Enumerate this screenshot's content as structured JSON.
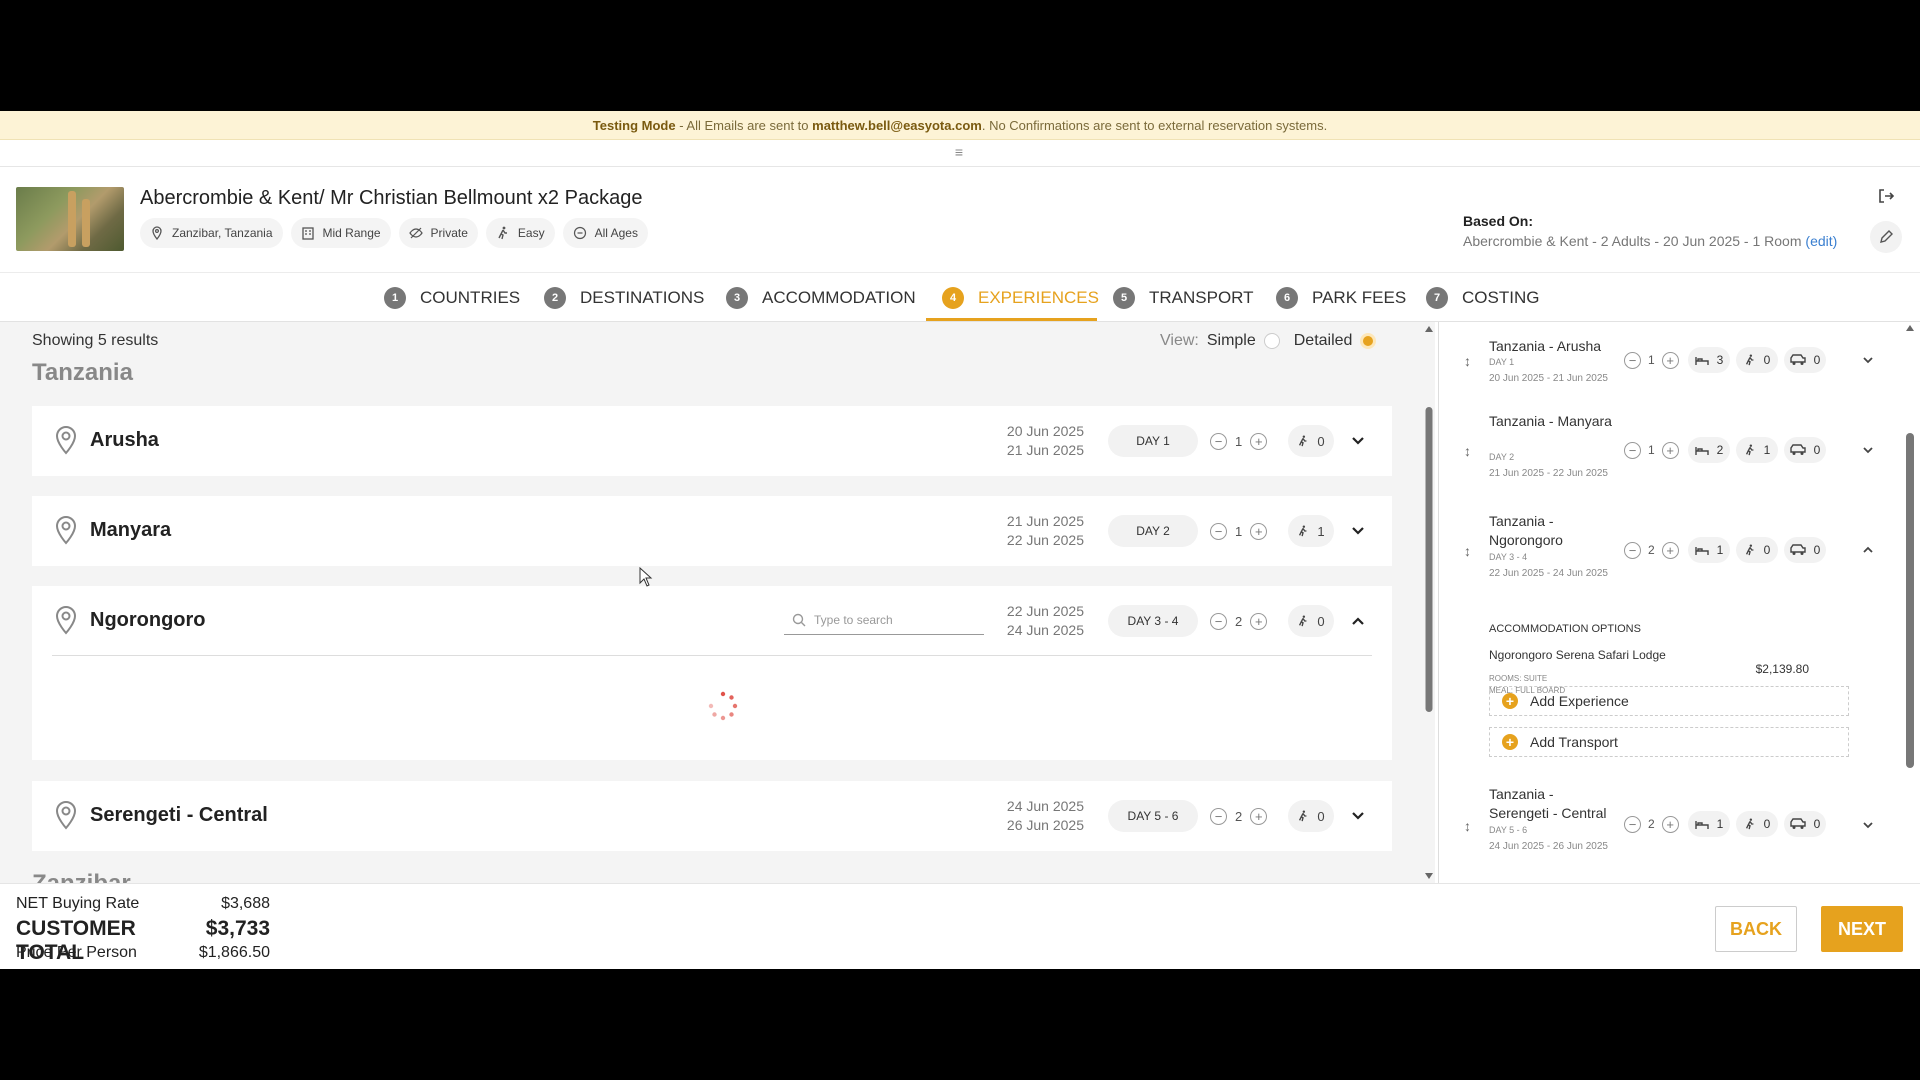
{
  "banner": {
    "mode": "Testing Mode",
    "pre": " - All Emails are sent to ",
    "email": "matthew.bell@easyota.com",
    "post": ". No Confirmations are sent to external reservation systems."
  },
  "drawer_handle": "≡",
  "package": {
    "title": "Abercrombie & Kent/ Mr Christian Bellmount x2 Package",
    "tags": [
      "Zanzibar, Tanzania",
      "Mid Range",
      "Private",
      "Easy",
      "All Ages"
    ]
  },
  "based_on": {
    "label": "Based On:",
    "value": "Abercrombie & Kent - 2 Adults - 20 Jun 2025 - 1 Room",
    "edit": "(edit)"
  },
  "steps": [
    {
      "num": "1",
      "label": "COUNTRIES"
    },
    {
      "num": "2",
      "label": "DESTINATIONS"
    },
    {
      "num": "3",
      "label": "ACCOMMODATION"
    },
    {
      "num": "4",
      "label": "EXPERIENCES"
    },
    {
      "num": "5",
      "label": "TRANSPORT"
    },
    {
      "num": "6",
      "label": "PARK FEES"
    },
    {
      "num": "7",
      "label": "COSTING"
    }
  ],
  "results": {
    "showing": "Showing 5 results",
    "view_label": "View:",
    "simple": "Simple",
    "detailed": "Detailed",
    "selected_view": "Detailed"
  },
  "countries": [
    "Tanzania",
    "Zanzibar"
  ],
  "search_placeholder": "Type to search",
  "destinations": [
    {
      "name": "Arusha",
      "date_from": "20 Jun 2025",
      "date_to": "21 Jun 2025",
      "day": "DAY 1",
      "nights": "1",
      "activities": "0"
    },
    {
      "name": "Manyara",
      "date_from": "21 Jun 2025",
      "date_to": "22 Jun 2025",
      "day": "DAY 2",
      "nights": "1",
      "activities": "1"
    },
    {
      "name": "Ngorongoro",
      "date_from": "22 Jun 2025",
      "date_to": "24 Jun 2025",
      "day": "DAY 3 - 4",
      "nights": "2",
      "activities": "0"
    },
    {
      "name": "Serengeti - Central",
      "date_from": "24 Jun 2025",
      "date_to": "26 Jun 2025",
      "day": "DAY 5 - 6",
      "nights": "2",
      "activities": "0"
    }
  ],
  "itinerary": [
    {
      "title": "Tanzania - Arusha",
      "day": "DAY 1",
      "range": "20 Jun 2025 - 21 Jun 2025",
      "nights": "1",
      "beds": "3",
      "activities": "0",
      "transport": "0"
    },
    {
      "title": "Tanzania - Manyara",
      "day": "DAY 2",
      "range": "21 Jun 2025 - 22 Jun 2025",
      "nights": "1",
      "beds": "2",
      "activities": "1",
      "transport": "0"
    },
    {
      "title": "Tanzania - Ngorongoro",
      "day": "DAY 3 - 4",
      "range": "22 Jun 2025 - 24 Jun 2025",
      "nights": "2",
      "beds": "1",
      "activities": "0",
      "transport": "0"
    },
    {
      "title": "Tanzania - Serengeti - Central",
      "day": "DAY 5 - 6",
      "range": "24 Jun 2025 - 26 Jun 2025",
      "nights": "2",
      "beds": "1",
      "activities": "0",
      "transport": "0"
    }
  ],
  "accommodation": {
    "title": "ACCOMMODATION OPTIONS",
    "name": "Ngorongoro Serena Safari Lodge",
    "rooms": "ROOMS: SUITE",
    "meal": "MEAL: FULL BOARD",
    "price": "$2,139.80",
    "add_experience": "Add Experience",
    "add_transport": "Add Transport"
  },
  "totals": {
    "net_label": "NET Buying Rate",
    "net_value": "$3,688",
    "customer_label": "CUSTOMER TOTAL",
    "customer_value": "$3,733",
    "ppp_label": "Price Per Person",
    "ppp_value": "$1,866.50"
  },
  "buttons": {
    "back": "BACK",
    "next": "NEXT"
  },
  "colors": {
    "accent": "#e6a21e",
    "banner_bg": "#fdf3d6"
  }
}
